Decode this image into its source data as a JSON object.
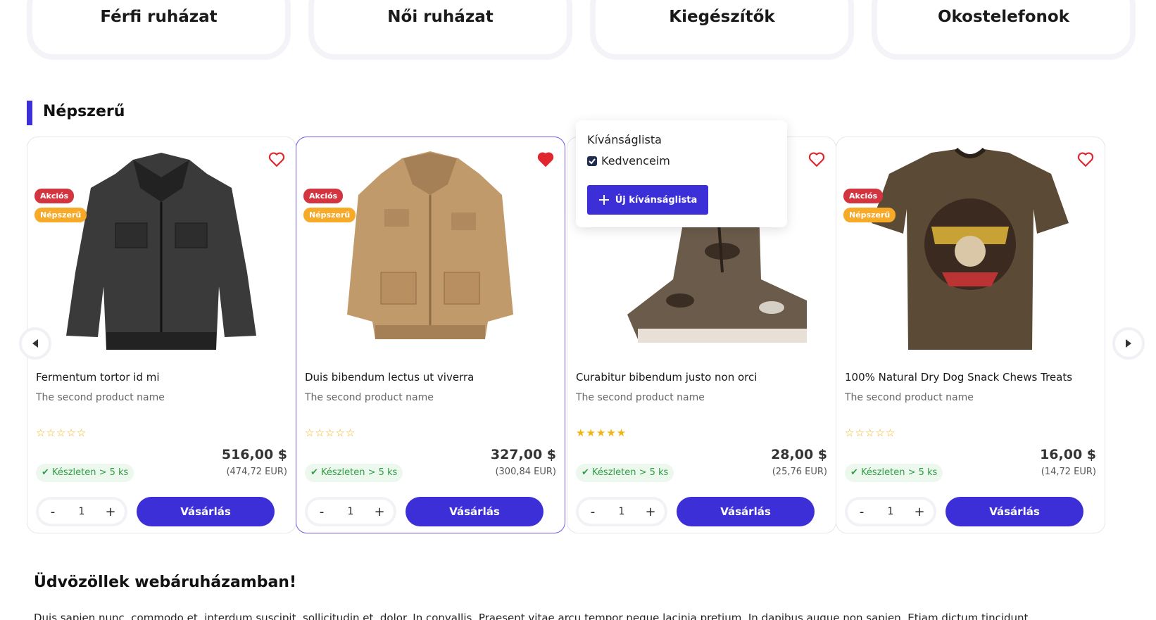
{
  "categories": [
    "Férfi ruházat",
    "Női ruházat",
    "Kiegészítők",
    "Okostelefonok"
  ],
  "section": {
    "title": "Népszerű"
  },
  "badges": {
    "sale": "Akciós",
    "popular": "Népszerű"
  },
  "products": [
    {
      "name": "Fermentum tortor id mi",
      "subtitle": "The second product name",
      "rating": 0,
      "price": "516,00 $",
      "price_eur": "(474,72 EUR)",
      "stock": "Készleten > 5 ks",
      "qty": "1",
      "buy_label": "Vásárlás",
      "badges": [
        "Akciós",
        "Népszerű"
      ],
      "wishlisted": false
    },
    {
      "name": "Duis bibendum lectus ut viverra",
      "subtitle": "The second product name",
      "rating": 0,
      "price": "327,00 $",
      "price_eur": "(300,84 EUR)",
      "stock": "Készleten > 5 ks",
      "qty": "1",
      "buy_label": "Vásárlás",
      "badges": [
        "Akciós",
        "Népszerű"
      ],
      "wishlisted": true
    },
    {
      "name": "Curabitur bibendum justo non orci",
      "subtitle": "The second product name",
      "rating": 5,
      "price": "28,00 $",
      "price_eur": "(25,76 EUR)",
      "stock": "Készleten > 5 ks",
      "qty": "1",
      "buy_label": "Vásárlás",
      "badges": [],
      "wishlisted": false
    },
    {
      "name": "100% Natural Dry Dog Snack Chews Treats",
      "subtitle": "The second product name",
      "rating": 0,
      "price": "16,00 $",
      "price_eur": "(14,72 EUR)",
      "stock": "Készleten > 5 ks",
      "qty": "1",
      "buy_label": "Vásárlás",
      "badges": [
        "Akciós",
        "Népszerű"
      ],
      "wishlisted": false
    }
  ],
  "wishlist_popup": {
    "title": "Kívánságlista",
    "item_label": "Kedvenceim",
    "item_checked": true,
    "new_button": "Új kívánságlista"
  },
  "welcome": {
    "title": "Üdvözöllek webáruházamban!",
    "paragraph": "Duis sapien nunc, commodo et, interdum suscipit, sollicitudin et, dolor. In convallis. Praesent vitae arcu tempor neque lacinia pretium. In dapibus augue non sapien. Etiam dictum tincidunt"
  },
  "colors": {
    "accent": "#3d2fd8",
    "sale_badge": "#d2353f",
    "popular_badge": "#f7a928",
    "heart": "#e0262e",
    "stock": "#2f9e44",
    "star": "#f2b613"
  },
  "icons": {
    "heart": "heart-icon",
    "prev": "chevron-left-icon",
    "next": "chevron-right-icon",
    "plus": "plus-icon",
    "check": "check-icon"
  }
}
